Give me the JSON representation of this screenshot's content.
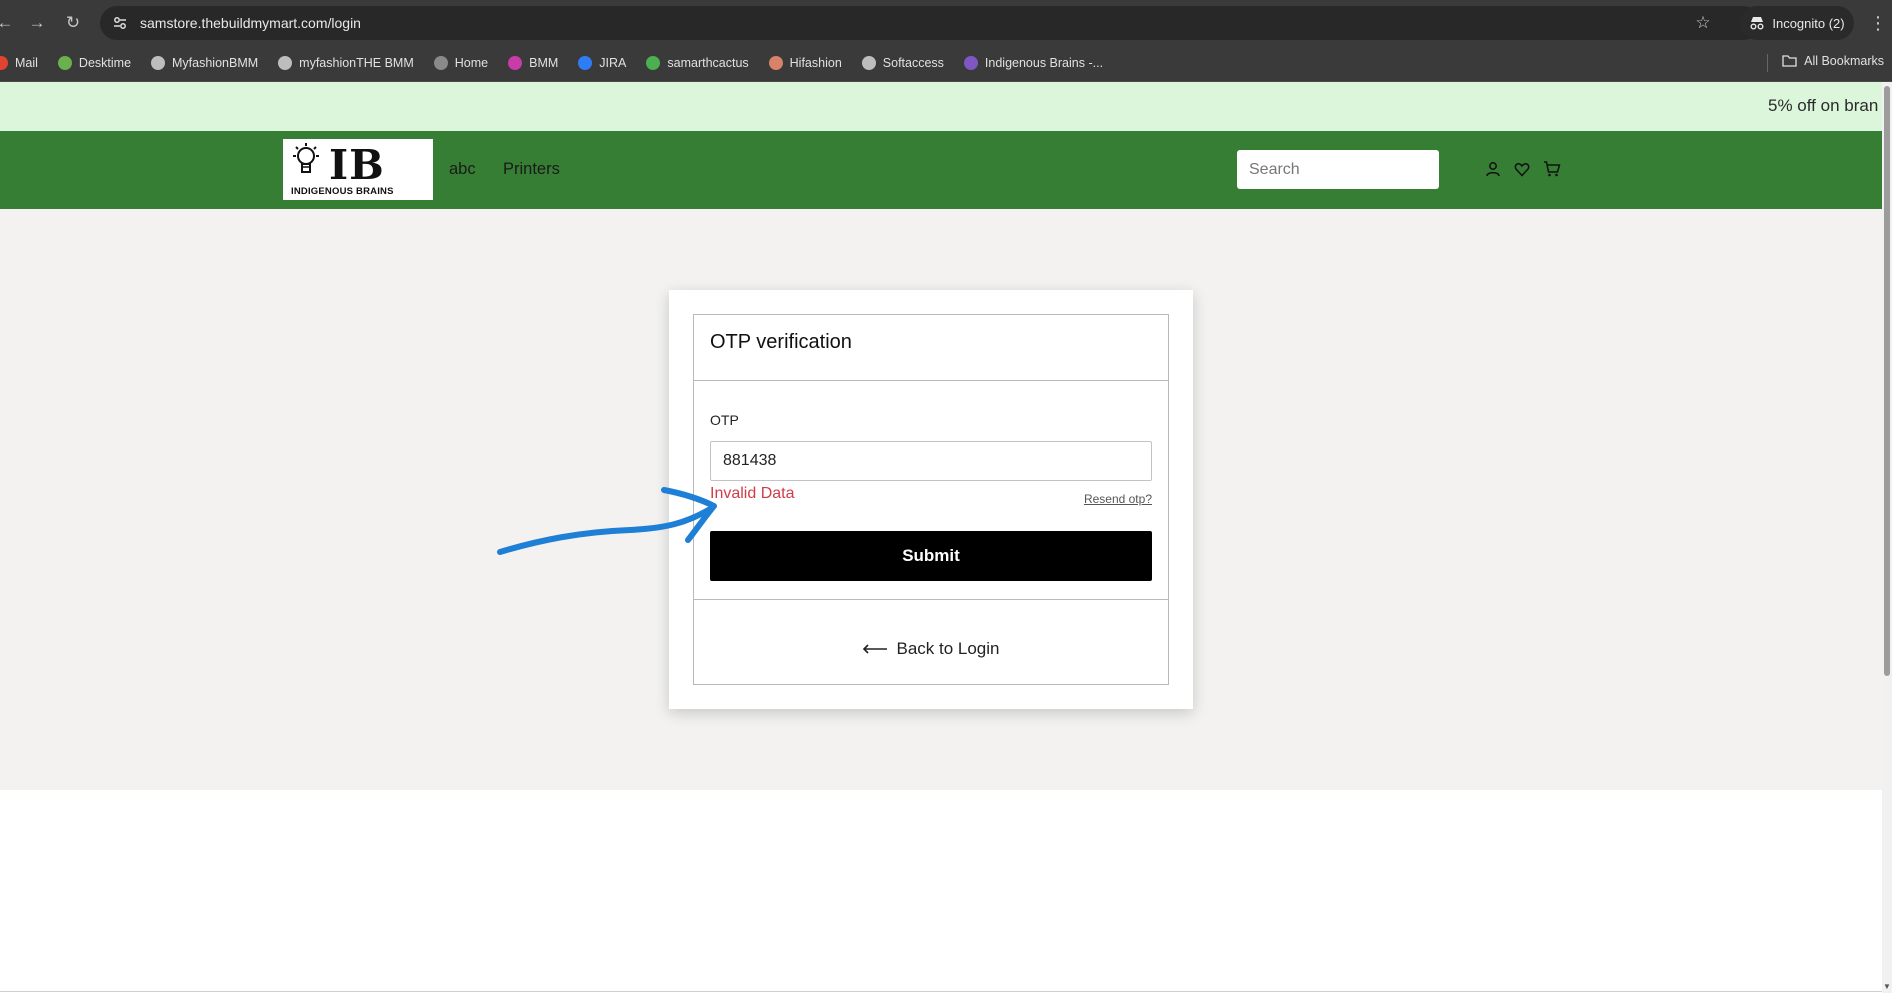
{
  "browser": {
    "url": "samstore.thebuildmymart.com/login",
    "incognito_label": "Incognito (2)",
    "bookmarks": [
      {
        "label": "Mail",
        "color": "#e0442f"
      },
      {
        "label": "Desktime",
        "color": "#6ab04c"
      },
      {
        "label": "MyfashionBMM",
        "color": "#bdbdbd"
      },
      {
        "label": "myfashionTHE BMM",
        "color": "#bdbdbd"
      },
      {
        "label": "Home",
        "color": "#8a8a8a"
      },
      {
        "label": "BMM",
        "color": "#c83caa"
      },
      {
        "label": "JIRA",
        "color": "#2e7df6"
      },
      {
        "label": "samarthcactus",
        "color": "#4caf50"
      },
      {
        "label": "Hifashion",
        "color": "#d9826a"
      },
      {
        "label": "Softaccess",
        "color": "#bdbdbd"
      },
      {
        "label": "Indigenous Brains -...",
        "color": "#7e57c2"
      }
    ],
    "all_bookmarks_label": "All Bookmarks"
  },
  "announcement": {
    "text": "5% off on bran"
  },
  "header": {
    "logo_mark": "IB",
    "logo_sub": "INDIGENOUS BRAINS",
    "nav": [
      "abc",
      "Printers"
    ],
    "search_placeholder": "Search"
  },
  "otp_card": {
    "title": "OTP verification",
    "otp_label": "OTP",
    "otp_value": "881438",
    "error": "Invalid Data",
    "resend": "Resend otp?",
    "submit": "Submit",
    "back": "Back to Login"
  },
  "colors": {
    "header_green": "#367e34",
    "announce_bg": "#dbf6da",
    "error_red": "#d23b48",
    "annotation_blue": "#1e7fd6"
  }
}
